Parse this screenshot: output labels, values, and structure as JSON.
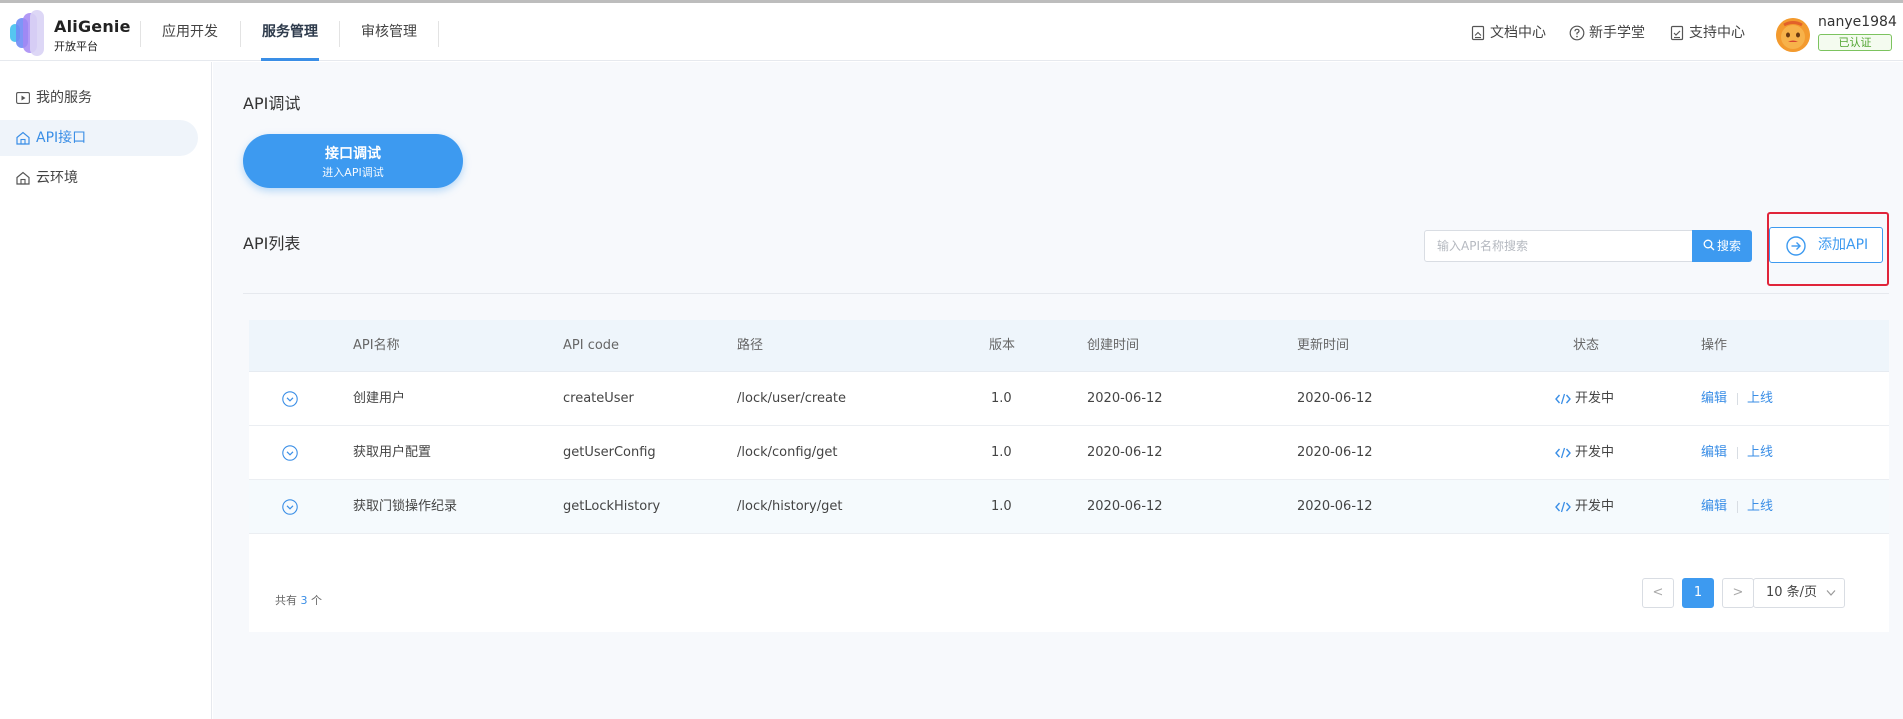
{
  "header": {
    "brand_name": "AliGenie",
    "brand_sub": "开放平台",
    "nav": [
      {
        "label": "应用开发",
        "active": false
      },
      {
        "label": "服务管理",
        "active": true
      },
      {
        "label": "审核管理",
        "active": false
      }
    ],
    "links": [
      {
        "label": "文档中心",
        "icon": "document-icon"
      },
      {
        "label": "新手学堂",
        "icon": "help-circle-icon"
      },
      {
        "label": "支持中心",
        "icon": "support-icon"
      }
    ],
    "username": "nanye1984",
    "verified_badge": "已认证"
  },
  "sidebar": {
    "items": [
      {
        "label": "我的服务",
        "icon": "play-square-icon",
        "active": false
      },
      {
        "label": "API接口",
        "icon": "home-icon",
        "active": true
      },
      {
        "label": "云环境",
        "icon": "home-icon",
        "active": false
      }
    ]
  },
  "main": {
    "debug_title": "API调试",
    "debug_button": {
      "title": "接口调试",
      "subtitle": "进入API调试"
    },
    "list_title": "API列表",
    "search": {
      "placeholder": "输入API名称搜索",
      "button": "搜索"
    },
    "add_button": "添加API",
    "table": {
      "columns": [
        "API名称",
        "API code",
        "路径",
        "版本",
        "创建时间",
        "更新时间",
        "状态",
        "操作"
      ],
      "rows": [
        {
          "name": "创建用户",
          "code": "createUser",
          "path": "/lock/user/create",
          "version": "1.0",
          "created": "2020-06-12",
          "updated": "2020-06-12",
          "status": "开发中",
          "op_edit": "编辑",
          "op_online": "上线"
        },
        {
          "name": "获取用户配置",
          "code": "getUserConfig",
          "path": "/lock/config/get",
          "version": "1.0",
          "created": "2020-06-12",
          "updated": "2020-06-12",
          "status": "开发中",
          "op_edit": "编辑",
          "op_online": "上线"
        },
        {
          "name": "获取门锁操作纪录",
          "code": "getLockHistory",
          "path": "/lock/history/get",
          "version": "1.0",
          "created": "2020-06-12",
          "updated": "2020-06-12",
          "status": "开发中",
          "op_edit": "编辑",
          "op_online": "上线"
        }
      ]
    },
    "pagination": {
      "total_prefix": "共有",
      "total_count": "3",
      "total_suffix": "个",
      "prev": "<",
      "current_page": "1",
      "next": ">",
      "page_size": "10 条/页"
    }
  },
  "colors": {
    "accent": "#3d9af0",
    "highlight_frame": "#e0253a",
    "verified": "#52a532"
  }
}
